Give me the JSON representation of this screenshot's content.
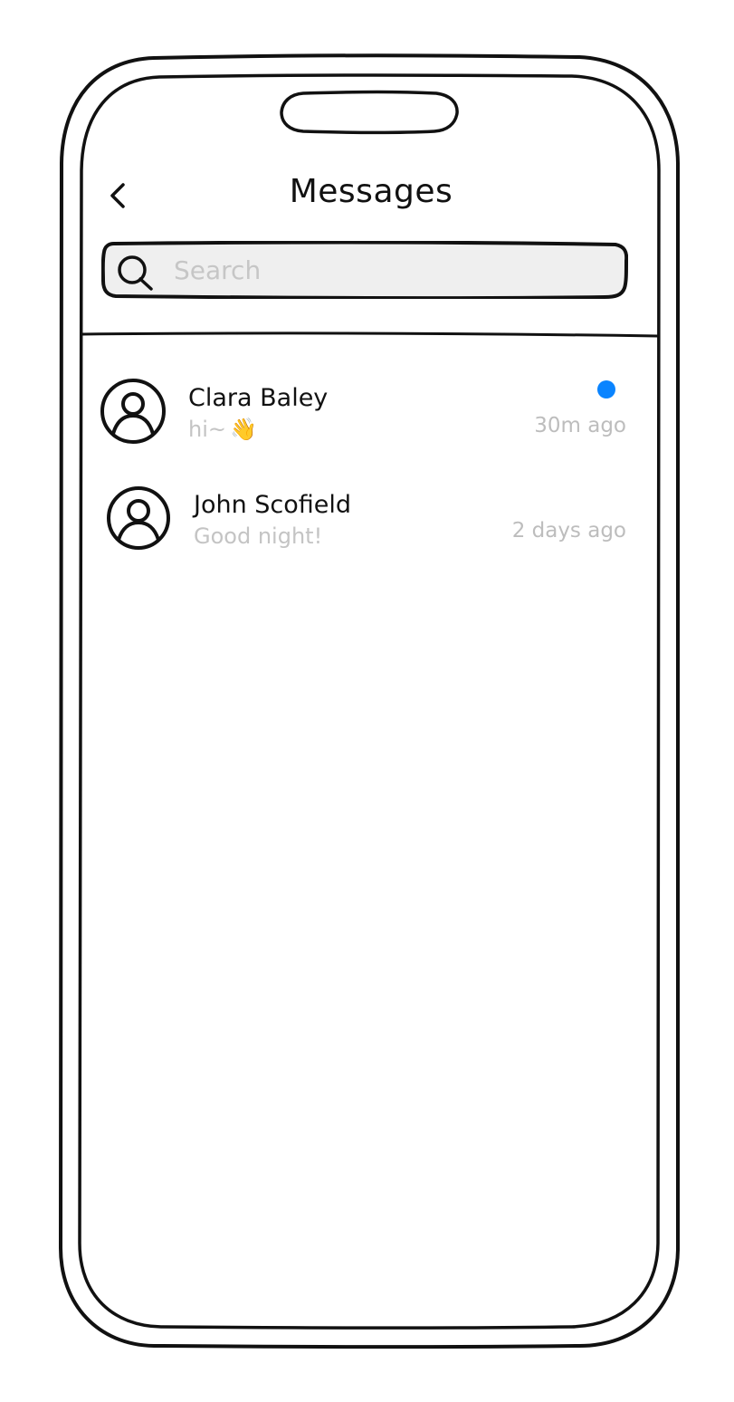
{
  "header": {
    "title": "Messages",
    "back_icon": "chevron-left-icon"
  },
  "search": {
    "placeholder": "Search",
    "value": "",
    "icon": "search-icon"
  },
  "conversations": [
    {
      "name": "Clara Baley",
      "preview": "hi~",
      "preview_emoji": "👋",
      "time": "30m ago",
      "unread": true,
      "avatar_icon": "user-avatar-icon"
    },
    {
      "name": "John Scofield",
      "preview": "Good night!",
      "time": "2 days ago",
      "unread": false,
      "avatar_icon": "user-avatar-icon"
    }
  ],
  "colors": {
    "unread_dot": "#0a84ff",
    "outline": "#111111",
    "search_fill": "#efefef",
    "muted_text": "#c4c4c4",
    "emoji": "#f2b41e"
  }
}
